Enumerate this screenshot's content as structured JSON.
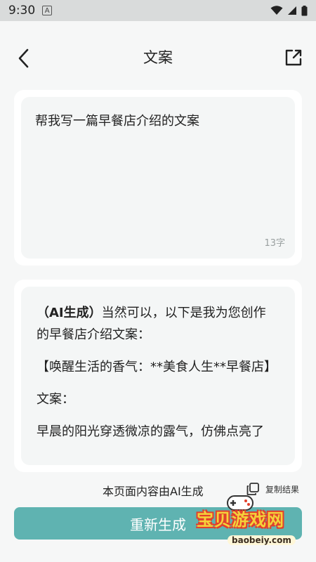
{
  "status_bar": {
    "time": "9:30",
    "notif": "A"
  },
  "header": {
    "title": "文案"
  },
  "prompt": {
    "text": "帮我写一篇早餐店介绍的文案",
    "char_count": "13字"
  },
  "result": {
    "ai_tag": "（AI生成）",
    "intro": "当然可以，以下是我为您创作的早餐店介绍文案：",
    "heading": "【唤醒生活的香气：**美食人生**早餐店】",
    "label": "文案：",
    "body": "早晨的阳光穿透微凉的露气，仿佛点亮了"
  },
  "footer": {
    "ai_note": "本页面内容由AI生成",
    "copy_label": "复制结果"
  },
  "action": {
    "regenerate_label": "重新生成"
  },
  "watermark": {
    "text": "宝贝游戏网",
    "url": "baobeiy.com"
  },
  "colors": {
    "accent": "#5fb3b1",
    "background": "#f6f7f7",
    "status_bar": "#d9dbdb"
  },
  "icons": {
    "back": "chevron-left-icon",
    "share": "share-icon",
    "copy": "copy-icon"
  }
}
